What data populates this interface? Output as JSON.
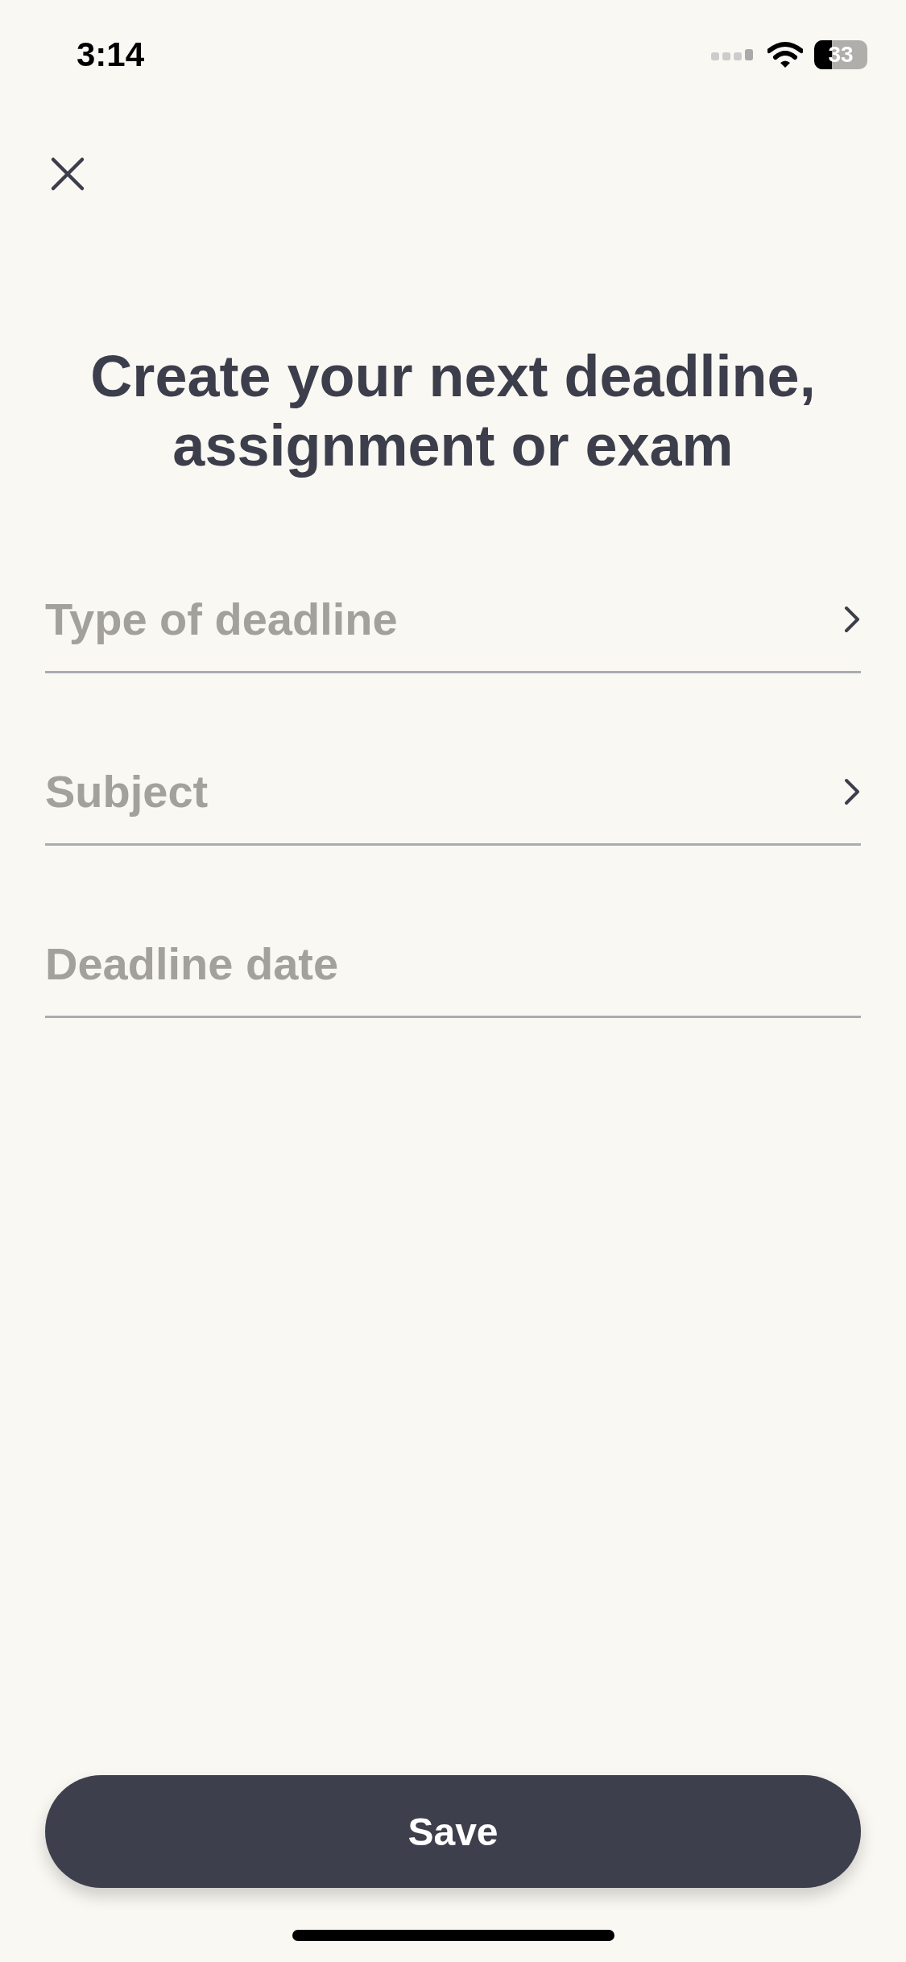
{
  "status_bar": {
    "time": "3:14",
    "battery": "33"
  },
  "title": "Create your next deadline, assignment or exam",
  "fields": [
    {
      "kind": "picker",
      "placeholder": "Type of deadline"
    },
    {
      "kind": "picker",
      "placeholder": "Subject"
    },
    {
      "kind": "date",
      "placeholder": "Deadline date"
    }
  ],
  "save_button": "Save"
}
